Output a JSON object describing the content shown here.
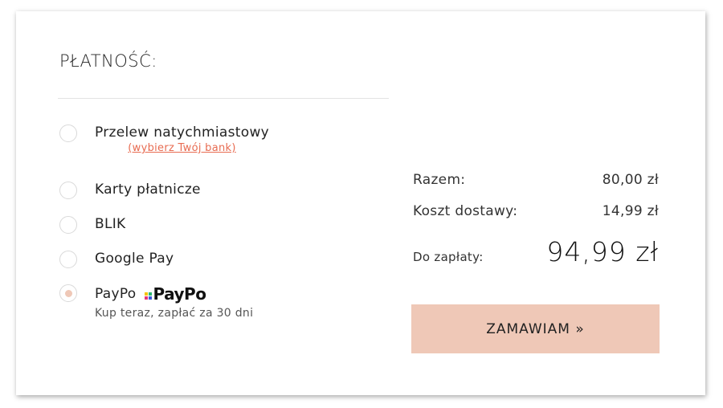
{
  "payment": {
    "title": "PŁATNOŚĆ:",
    "options": [
      {
        "label": "Przelew natychmiastowy",
        "link": "(wybierz Twój bank)",
        "checked": false
      },
      {
        "label": "Karty płatnicze",
        "checked": false
      },
      {
        "label": "BLIK",
        "checked": false
      },
      {
        "label": "Google Pay",
        "checked": false
      },
      {
        "label": "PayPo",
        "logo_text": "PayPo",
        "sub": "Kup teraz, zapłać za 30 dni",
        "checked": true
      }
    ]
  },
  "summary": {
    "subtotal_label": "Razem:",
    "subtotal_value": "80,00 zł",
    "shipping_label": "Koszt dostawy:",
    "shipping_value": "14,99 zł",
    "total_label": "Do zapłaty:",
    "total_value": "94,99 zł"
  },
  "order_button": "ZAMAWIAM »",
  "colors": {
    "accent": "#efc8b7",
    "link": "#e86c52",
    "paypo_dots": [
      "#f5c400",
      "#2bb673",
      "#e6367a",
      "#3b5bdb"
    ]
  }
}
